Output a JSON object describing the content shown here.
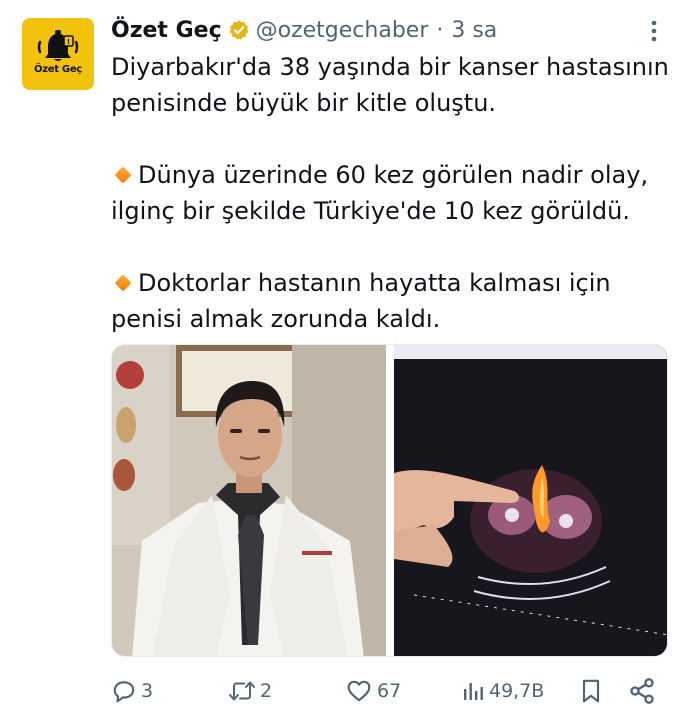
{
  "tweet": {
    "author": {
      "display_name": "Özet Geç",
      "handle": "@ozetgechaber",
      "verified_badge": "gold-verified-icon",
      "avatar": {
        "text": "Özet Geç",
        "background": "#f2c20c"
      }
    },
    "separator": "·",
    "time": "3 sa",
    "text": {
      "line1": "Diyarbakır'da 38 yaşında bir kanser hastasının penisinde büyük bir kitle oluştu.",
      "line2": "Dünya üzerinde 60 kez görülen nadir olay, ilginç bir şekilde Türkiye'de 10 kez görüldü.",
      "line3": "Doktorlar hastanın hayatta kalması için penisi almak zorunda kaldı.",
      "bullet_icon": "orange-diamond-icon"
    },
    "media": [
      {
        "name": "doctor-photo"
      },
      {
        "name": "scan-photo"
      }
    ],
    "actions": {
      "replies": "3",
      "retweets": "2",
      "likes": "67",
      "views": "49,7B"
    }
  },
  "colors": {
    "text": "#0f1419",
    "secondary": "#536471",
    "verified_gold": "#e2b719",
    "bullet": "#f57c00"
  }
}
